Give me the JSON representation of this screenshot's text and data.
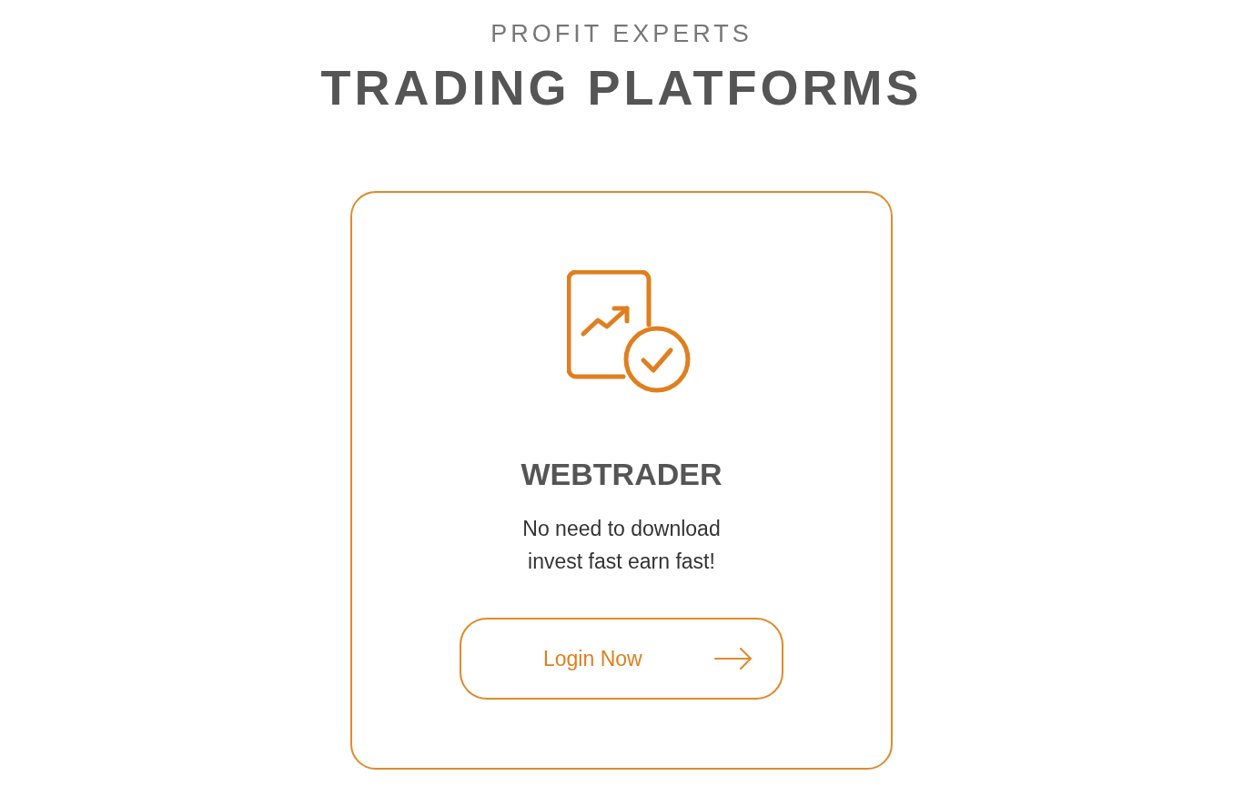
{
  "header": {
    "eyebrow": "PROFIT EXPERTS",
    "title": "TRADING PLATFORMS"
  },
  "platform_card": {
    "title": "WEBTRADER",
    "description": "No need to download\ninvest fast earn fast!",
    "button": {
      "label": "Login Now"
    }
  }
}
